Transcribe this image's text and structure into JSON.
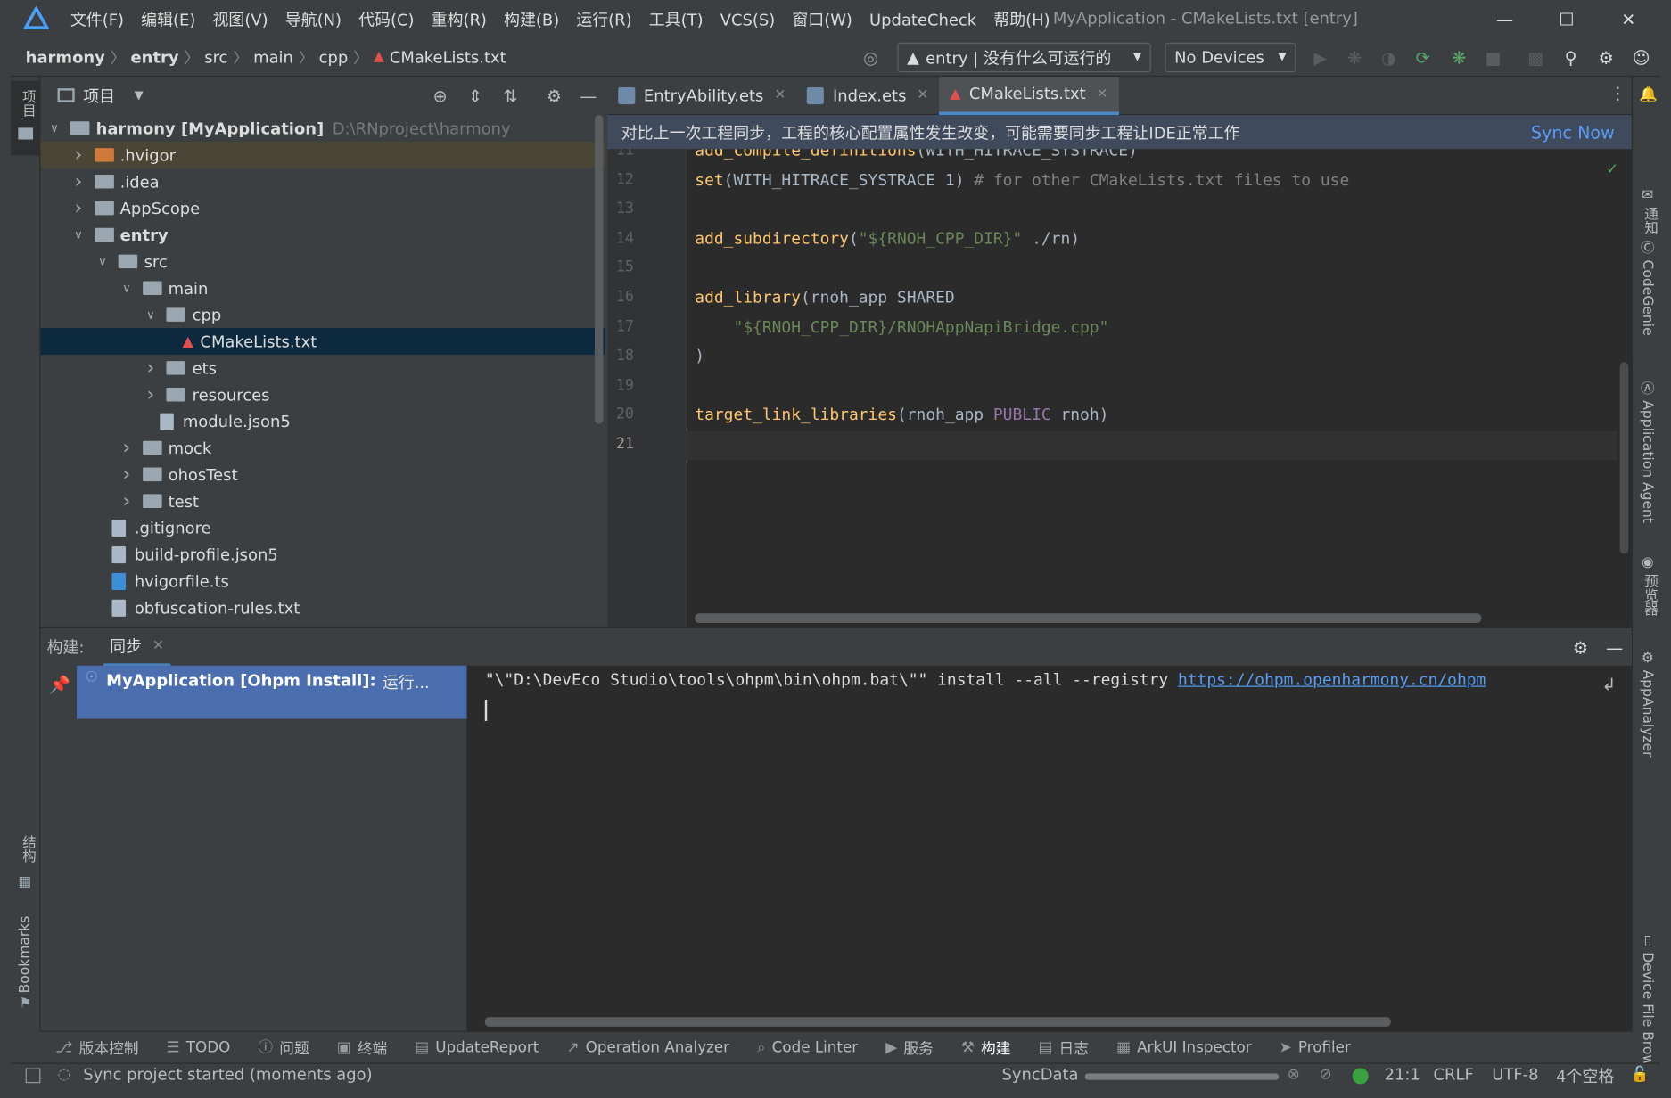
{
  "titlebar": {
    "menu": [
      "文件(F)",
      "编辑(E)",
      "视图(V)",
      "导航(N)",
      "代码(C)",
      "重构(R)",
      "构建(B)",
      "运行(R)",
      "工具(T)",
      "VCS(S)",
      "窗口(W)",
      "UpdateCheck",
      "帮助(H)"
    ],
    "title": "MyApplication - CMakeLists.txt [entry]"
  },
  "breadcrumbs": [
    "harmony",
    "entry",
    "src",
    "main",
    "cpp",
    "CMakeLists.txt"
  ],
  "toolbar": {
    "run_config": "entry | 没有什么可运行的",
    "device": "No Devices"
  },
  "project_panel": {
    "title": "项目",
    "root": {
      "name": "harmony [MyApplication]",
      "path": "D:\\RNproject\\harmony"
    },
    "nodes": [
      {
        "label": ".hvigor",
        "type": "folder-orange",
        "level": 1,
        "expand": "collapsed"
      },
      {
        "label": ".idea",
        "type": "folder",
        "level": 1,
        "expand": "collapsed"
      },
      {
        "label": "AppScope",
        "type": "folder",
        "level": 1,
        "expand": "collapsed"
      },
      {
        "label": "entry",
        "type": "folder",
        "level": 1,
        "expand": "expanded"
      },
      {
        "label": "src",
        "type": "folder",
        "level": 2,
        "expand": "expanded"
      },
      {
        "label": "main",
        "type": "folder",
        "level": 3,
        "expand": "expanded"
      },
      {
        "label": "cpp",
        "type": "folder",
        "level": 4,
        "expand": "expanded"
      },
      {
        "label": "CMakeLists.txt",
        "type": "cmake",
        "level": 5,
        "expand": "none"
      },
      {
        "label": "ets",
        "type": "folder",
        "level": 4,
        "expand": "collapsed"
      },
      {
        "label": "resources",
        "type": "folder",
        "level": 4,
        "expand": "collapsed"
      },
      {
        "label": "module.json5",
        "type": "file",
        "level": 4,
        "expand": "none"
      },
      {
        "label": "mock",
        "type": "folder",
        "level": 3,
        "expand": "collapsed"
      },
      {
        "label": "ohosTest",
        "type": "folder",
        "level": 3,
        "expand": "collapsed"
      },
      {
        "label": "test",
        "type": "folder",
        "level": 3,
        "expand": "collapsed"
      },
      {
        "label": ".gitignore",
        "type": "file",
        "level": 2,
        "expand": "none"
      },
      {
        "label": "build-profile.json5",
        "type": "file",
        "level": 2,
        "expand": "none"
      },
      {
        "label": "hvigorfile.ts",
        "type": "file-ts",
        "level": 2,
        "expand": "none"
      },
      {
        "label": "obfuscation-rules.txt",
        "type": "file",
        "level": 2,
        "expand": "none"
      }
    ]
  },
  "editor": {
    "tabs": [
      {
        "label": "EntryAbility.ets",
        "active": false
      },
      {
        "label": "Index.ets",
        "active": false
      },
      {
        "label": "CMakeLists.txt",
        "active": true
      }
    ],
    "banner": "对比上一次工程同步，工程的核心配置属性发生改变，可能需要同步工程让IDE正常工作",
    "sync_now": "Sync Now",
    "lines": [
      {
        "n": "11",
        "html": "<span class='fn'>add_compile_definitions</span>(WITH_HITRACE_SYSTRACE)"
      },
      {
        "n": "12",
        "html": "<span class='fn'>set</span>(WITH_HITRACE_SYSTRACE 1) <span class='cm'># for other CMakeLists.txt files to use</span>"
      },
      {
        "n": "13",
        "html": ""
      },
      {
        "n": "14",
        "html": "<span class='fn'>add_subdirectory</span>(<span class='str'>\"${RNOH_CPP_DIR}\"</span> ./rn)"
      },
      {
        "n": "15",
        "html": ""
      },
      {
        "n": "16",
        "html": "<span class='fn'>add_library</span>(rnoh_app SHARED"
      },
      {
        "n": "17",
        "html": "    <span class='str'>\"${RNOH_CPP_DIR}/RNOHAppNapiBridge.cpp\"</span>"
      },
      {
        "n": "18",
        "html": ")"
      },
      {
        "n": "19",
        "html": ""
      },
      {
        "n": "20",
        "html": "<span class='fn'>target_link_libraries</span>(rnoh_app <span class='pub'>PUBLIC</span> rnoh)"
      },
      {
        "n": "21",
        "html": ""
      }
    ]
  },
  "build_panel": {
    "label": "构建:",
    "tab": "同步",
    "task": "MyApplication [Ohpm Install]:",
    "task_status": "运行...",
    "console_text": "\"\\\"D:\\DevEco Studio\\tools\\ohpm\\bin\\ohpm.bat\\\"\" install --all --registry ",
    "console_link": "https://ohpm.openharmony.cn/ohpm"
  },
  "bottom_tools": [
    {
      "label": "版本控制",
      "icon": "vcs-icon"
    },
    {
      "label": "TODO",
      "icon": "list-icon"
    },
    {
      "label": "问题",
      "icon": "info-icon"
    },
    {
      "label": "终端",
      "icon": "terminal-icon"
    },
    {
      "label": "UpdateReport",
      "icon": "report-icon"
    },
    {
      "label": "Operation Analyzer",
      "icon": "chart-icon"
    },
    {
      "label": "Code Linter",
      "icon": "search-icon"
    },
    {
      "label": "服务",
      "icon": "play-icon"
    },
    {
      "label": "构建",
      "icon": "hammer-icon"
    },
    {
      "label": "日志",
      "icon": "log-icon"
    },
    {
      "label": "ArkUI Inspector",
      "icon": "inspector-icon"
    },
    {
      "label": "Profiler",
      "icon": "profiler-icon"
    }
  ],
  "status": {
    "message": "Sync project started (moments ago)",
    "task": "SyncData",
    "position": "21:1",
    "line_sep": "CRLF",
    "encoding": "UTF-8",
    "indent": "4个空格"
  },
  "left_stripe": {
    "project": "项目",
    "structure": "结构",
    "bookmarks": "Bookmarks"
  },
  "right_stripe": [
    "通知",
    "CodeGenie",
    "Application Agent",
    "预览器",
    "AppAnalyzer",
    "Device File Browser"
  ],
  "colors": {
    "accent": "#4a88c7",
    "selection": "#0d293e",
    "build_selected": "#4b6eaf",
    "link": "#589df6"
  }
}
